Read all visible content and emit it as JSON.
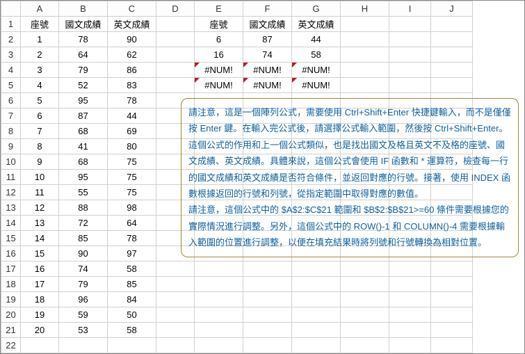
{
  "columns": [
    "A",
    "B",
    "C",
    "D",
    "E",
    "F",
    "G",
    "H",
    "I",
    "J"
  ],
  "row_count": 22,
  "headers_left": {
    "A": "座號",
    "B": "國文成績",
    "C": "英文成績"
  },
  "headers_right": {
    "E": "座號",
    "F": "國文成績",
    "G": "英文成績"
  },
  "left_rows": [
    {
      "A": "1",
      "B": "78",
      "C": "90"
    },
    {
      "A": "2",
      "B": "64",
      "C": "62"
    },
    {
      "A": "3",
      "B": "79",
      "C": "86"
    },
    {
      "A": "4",
      "B": "52",
      "C": "83"
    },
    {
      "A": "5",
      "B": "95",
      "C": "78"
    },
    {
      "A": "6",
      "B": "87",
      "C": "44"
    },
    {
      "A": "7",
      "B": "68",
      "C": "69"
    },
    {
      "A": "8",
      "B": "41",
      "C": "80"
    },
    {
      "A": "9",
      "B": "68",
      "C": "75"
    },
    {
      "A": "10",
      "B": "95",
      "C": "75"
    },
    {
      "A": "11",
      "B": "55",
      "C": "75"
    },
    {
      "A": "12",
      "B": "88",
      "C": "98"
    },
    {
      "A": "13",
      "B": "72",
      "C": "64"
    },
    {
      "A": "14",
      "B": "85",
      "C": "78"
    },
    {
      "A": "15",
      "B": "90",
      "C": "97"
    },
    {
      "A": "16",
      "B": "74",
      "C": "58"
    },
    {
      "A": "17",
      "B": "79",
      "C": "85"
    },
    {
      "A": "18",
      "B": "96",
      "C": "84"
    },
    {
      "A": "19",
      "B": "59",
      "C": "50"
    },
    {
      "A": "20",
      "B": "53",
      "C": "58"
    }
  ],
  "right_rows": [
    {
      "E": "6",
      "F": "87",
      "G": "44"
    },
    {
      "E": "16",
      "F": "74",
      "G": "58"
    },
    {
      "E": "#NUM!",
      "F": "#NUM!",
      "G": "#NUM!",
      "err": true
    },
    {
      "E": "#NUM!",
      "F": "#NUM!",
      "G": "#NUM!",
      "err": true
    }
  ],
  "note_lines": [
    "請注意，這是一個陣列公式，需要使用 Ctrl+Shift+Enter 快捷鍵輸入，而不是僅僅按 Enter 鍵。在輸入完公式後，請選擇公式輸入範圍，然後按 Ctrl+Shift+Enter。",
    "這個公式的作用和上一個公式類似，也是找出國文及格且英文不及格的座號、國文成績、英文成績。具體來說，這個公式會使用 IF 函數和 * 運算符，檢查每一行的國文成績和英文成績是否符合條件，並返回對應的行號。接著，使用 INDEX 函數根據返回的行號和列號，從指定範圍中取得對應的數值。",
    "請注意，這個公式中的 $A$2:$C$21 範圍和 $B$2:$B$21>=60 條件需要根據您的實際情況進行調整。另外，這個公式中的 ROW()-1 和 COLUMN()-4 需要根據輸入範圍的位置進行調整，以便在填充結果時將列號和行號轉換為相對位置。"
  ]
}
